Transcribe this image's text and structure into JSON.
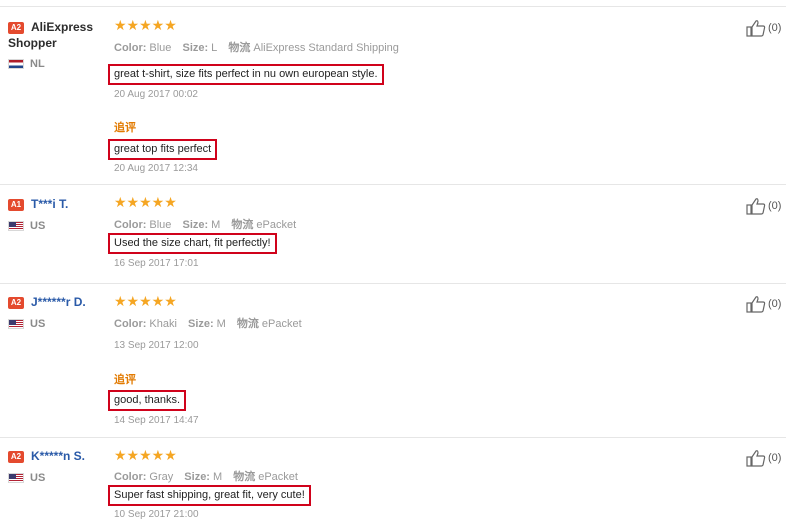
{
  "reviews": [
    {
      "badge": "A2",
      "name_line1": "AliExpress",
      "name_line2": "Shopper",
      "country": "NL",
      "stars": "★★★★★",
      "color_label": "Color:",
      "color": "Blue",
      "size_label": "Size:",
      "size": "L",
      "ship_label": "物流",
      "shipping": "AliExpress Standard Shipping",
      "text": "great t-shirt, size fits perfect in nu own european style.",
      "date": "20 Aug 2017 00:02",
      "followup_label": "追评",
      "followup_text": "great top fits perfect",
      "followup_date": "20 Aug 2017 12:34",
      "likes": "(0)"
    },
    {
      "badge": "A1",
      "name": "T***i T.",
      "country": "US",
      "stars": "★★★★★",
      "color_label": "Color:",
      "color": "Blue",
      "size_label": "Size:",
      "size": "M",
      "ship_label": "物流",
      "shipping": "ePacket",
      "text": "Used the size chart, fit perfectly!",
      "date": "16 Sep 2017 17:01",
      "likes": "(0)"
    },
    {
      "badge": "A2",
      "name": "J******r D.",
      "country": "US",
      "stars": "★★★★★",
      "color_label": "Color:",
      "color": "Khaki",
      "size_label": "Size:",
      "size": "M",
      "ship_label": "物流",
      "shipping": "ePacket",
      "date": "13 Sep 2017 12:00",
      "followup_label": "追评",
      "followup_text": "good, thanks.",
      "followup_date": "14 Sep 2017 14:47",
      "likes": "(0)"
    },
    {
      "badge": "A2",
      "name": "K*****n S.",
      "country": "US",
      "stars": "★★★★★",
      "color_label": "Color:",
      "color": "Gray",
      "size_label": "Size:",
      "size": "M",
      "ship_label": "物流",
      "shipping": "ePacket",
      "text": "Super fast shipping, great fit, very cute!",
      "date": "10 Sep 2017 21:00",
      "likes": "(0)"
    }
  ]
}
